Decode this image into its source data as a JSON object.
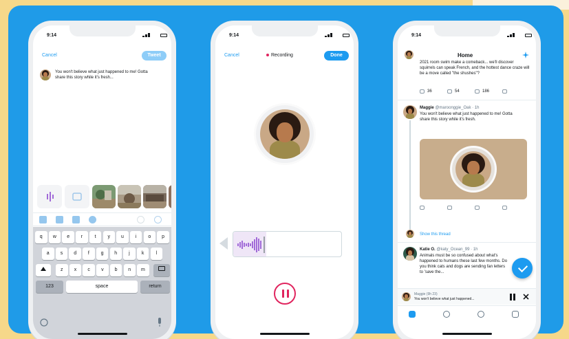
{
  "phone1": {
    "status_time": "9:14",
    "cancel_label": "Cancel",
    "tweet_label": "Tweet",
    "compose_text": "You won't believe what just happened to me! Gotta share this story while it's fresh...",
    "keyboard": {
      "row1": [
        "q",
        "w",
        "e",
        "r",
        "t",
        "y",
        "u",
        "i",
        "o",
        "p"
      ],
      "row2": [
        "a",
        "s",
        "d",
        "f",
        "g",
        "h",
        "j",
        "k",
        "l"
      ],
      "row3": [
        "z",
        "x",
        "c",
        "v",
        "b",
        "n",
        "m"
      ],
      "num_label": "123",
      "space_label": "space",
      "return_label": "return"
    }
  },
  "phone2": {
    "status_time": "9:14",
    "cancel_label": "Cancel",
    "recording_label": "Recording",
    "done_label": "Done"
  },
  "phone3": {
    "status_time": "9:14",
    "title": "Home",
    "prev_tweet_text": "2021 room swim make a comeback... we'll discover squirrels can speak French, and the hottest dance craze will be a move called \"the shushes\"?",
    "prev_counts": {
      "reply": "36",
      "retweet": "54",
      "like": "186"
    },
    "tweet": {
      "name": "Maggie",
      "handle": "@maroonggie_Oak · 1h",
      "text": "You won't believe what just happened to me! Gotta share this story while it's fresh."
    },
    "show_thread_label": "Show this thread",
    "tweet2": {
      "name": "Katie O.",
      "handle": "@katy_Ocean_99 · 1h",
      "text": "Animals must be so confused about what's happened to humans these last few months. Do you think cats and dogs are sending fan letters to 'save the..."
    },
    "dock_title": "Maggie (9h 23)",
    "dock_subtitle": "You won't believe what just happened..."
  }
}
